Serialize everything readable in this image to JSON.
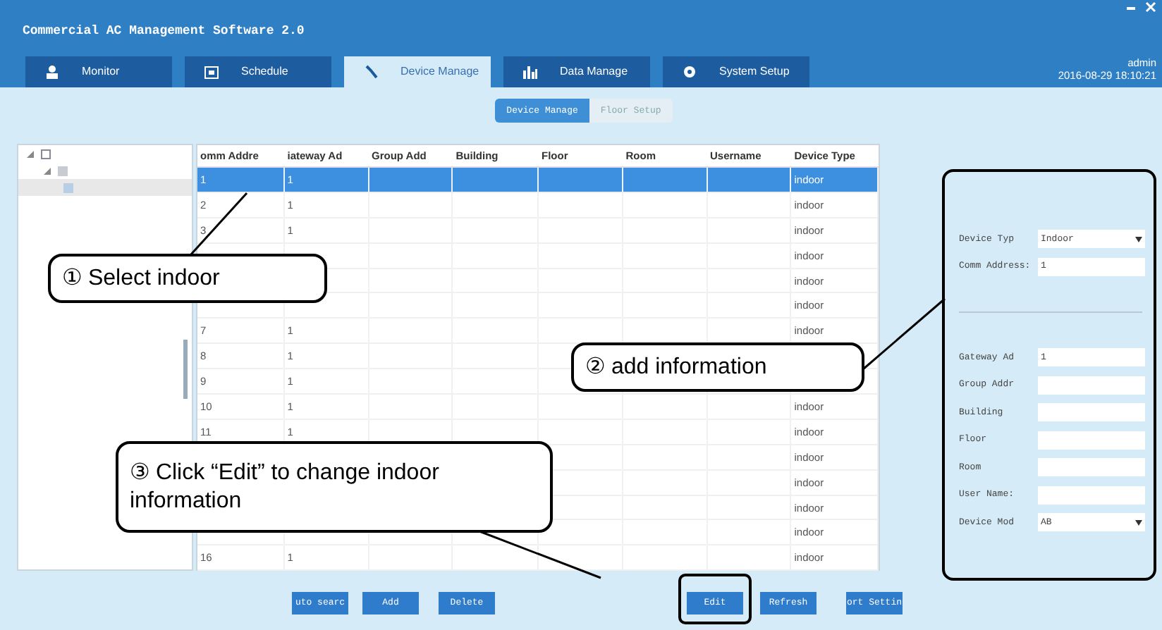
{
  "window": {
    "title": "Commercial AC Management Software 2.0"
  },
  "tabs": [
    {
      "label": "Monitor",
      "selected": false
    },
    {
      "label": "Schedule",
      "selected": false
    },
    {
      "label": "Device Manage",
      "selected": true
    },
    {
      "label": "Data Manage",
      "selected": false
    },
    {
      "label": "System Setup",
      "selected": false
    }
  ],
  "user": {
    "name": "admin",
    "datetime": "2016-08-29 18:10:21"
  },
  "sub_tabs": [
    {
      "label": "Device Manage",
      "selected": true
    },
    {
      "label": "Floor Setup",
      "selected": false
    }
  ],
  "tree": [
    {
      "expanded": true,
      "selected": false,
      "children": [
        {
          "expanded": true,
          "selected": false,
          "children": [
            {
              "selected": true
            }
          ]
        }
      ]
    }
  ],
  "table": {
    "columns": [
      "omm Addre",
      "iateway Ad",
      "Group Add",
      "Building",
      "Floor",
      "Room",
      "Username",
      "Device Type"
    ],
    "rows": [
      {
        "comm": "1",
        "gateway": "1",
        "device_type": "indoor",
        "selected": true
      },
      {
        "comm": "2",
        "gateway": "1",
        "device_type": "indoor",
        "selected": false
      },
      {
        "comm": "3",
        "gateway": "1",
        "device_type": "indoor",
        "selected": false
      },
      {
        "device_type": "indoor",
        "selected": false
      },
      {
        "device_type": "indoor",
        "selected": false
      },
      {
        "device_type": "indoor",
        "selected": false
      },
      {
        "comm": "7",
        "gateway": "1",
        "device_type": "indoor",
        "selected": false
      },
      {
        "comm": "8",
        "gateway": "1",
        "selected": false
      },
      {
        "comm": "9",
        "gateway": "1",
        "selected": false
      },
      {
        "comm": "10",
        "gateway": "1",
        "device_type": "indoor",
        "selected": false
      },
      {
        "comm": "11",
        "gateway": "1",
        "device_type": "indoor",
        "selected": false
      },
      {
        "device_type": "indoor",
        "selected": false
      },
      {
        "device_type": "indoor",
        "selected": false
      },
      {
        "device_type": "indoor",
        "selected": false
      },
      {
        "device_type": "indoor",
        "selected": false
      },
      {
        "comm": "16",
        "gateway": "1",
        "device_type": "indoor",
        "selected": false
      }
    ]
  },
  "form": {
    "highlighted": true,
    "fields": [
      {
        "kind": "select",
        "label": "Device Typ",
        "value": "Indoor"
      },
      {
        "kind": "text",
        "label": "Comm Address:",
        "value": "1"
      },
      {
        "kind": "divider"
      },
      {
        "kind": "text",
        "label": "Gateway Ad",
        "value": "1"
      },
      {
        "kind": "text",
        "label": "Group Addr"
      },
      {
        "kind": "text",
        "label": "Building"
      },
      {
        "kind": "text",
        "label": "Floor"
      },
      {
        "kind": "text",
        "label": "Room"
      },
      {
        "kind": "text",
        "label": "User Name:"
      },
      {
        "kind": "select",
        "label": "Device Mod",
        "value": "AB"
      }
    ]
  },
  "buttons": [
    {
      "label": "uto searc",
      "highlighted": false
    },
    {
      "label": "Add",
      "highlighted": false
    },
    {
      "label": "Delete",
      "highlighted": false
    },
    {
      "label": "Edit",
      "highlighted": true
    },
    {
      "label": "Refresh",
      "highlighted": false
    },
    {
      "label": "ort Settin",
      "highlighted": false
    }
  ],
  "callouts": [
    {
      "text": "① Select indoor"
    },
    {
      "text": "② add information"
    },
    {
      "text": "③ Click “Edit” to change indoor information"
    }
  ]
}
